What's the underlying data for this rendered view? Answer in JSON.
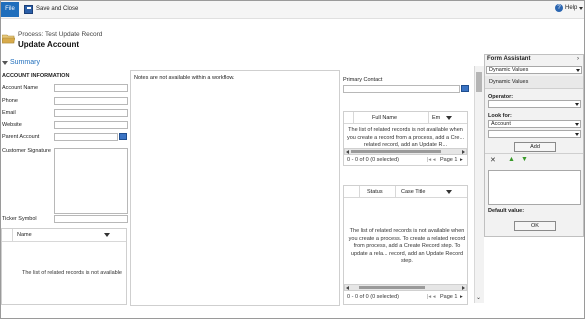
{
  "ribbon": {
    "file_tab": "File",
    "save_close": "Save and Close",
    "help": "Help"
  },
  "header": {
    "process": "Process: Test Update Record",
    "title": "Update Account",
    "summary": "Summary"
  },
  "account_section": {
    "heading": "ACCOUNT INFORMATION",
    "fields": [
      "Account Name",
      "Phone",
      "Email",
      "Website",
      "Parent Account",
      "Customer Signature",
      "Ticker Symbol"
    ],
    "grid_column": "Name",
    "grid_message": "The list of related records is not available"
  },
  "notes_message": "Notes are not available within a workflow.",
  "contact_section": {
    "primary_contact_label": "Primary Contact",
    "grid1": {
      "columns": [
        "Full Name",
        "Em"
      ],
      "message": "The list of related records is not available when you create a record from a process, add a Cre... related record, add an Update R...",
      "count": "0 - 0 of 0 (0 selected)",
      "page": "Page 1"
    },
    "grid2": {
      "columns": [
        "Status",
        "Case Title"
      ],
      "message": "The list of related records is not available when you create a process. To create a related record from process, add a Create Record step. To update a rela... record, add an Update Record step.",
      "count": "0 - 0 of 0 (0 selected)",
      "page": "Page 1"
    }
  },
  "form_assistant": {
    "title": "Form Assistant",
    "dropdown": "Dynamic Values",
    "section": "Dynamic Values",
    "operator_label": "Operator:",
    "look_for_label": "Look for:",
    "look_for_value": "Account",
    "add_button": "Add",
    "default_value_label": "Default value:",
    "ok_button": "OK"
  },
  "colors": {
    "accent": "#1f6ebc",
    "add_arrow": "#3a9a2a"
  }
}
